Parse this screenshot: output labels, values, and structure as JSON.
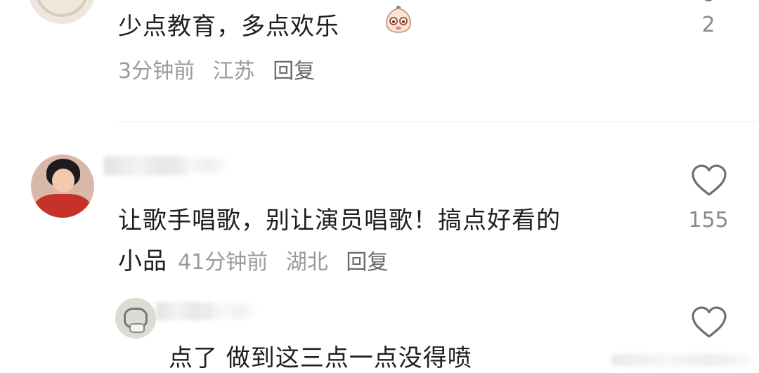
{
  "comments": [
    {
      "text": "少点教育，多点欢乐",
      "emoji": "peach-face-emoji",
      "meta": {
        "time": "3分钟前",
        "location": "江苏",
        "reply": "回复"
      },
      "likes": "2"
    },
    {
      "text_line1": "让歌手唱歌，别让演员唱歌！搞点好看的",
      "text_line2": "小品",
      "meta": {
        "time": "41分钟前",
        "location": "湖北",
        "reply": "回复"
      },
      "likes": "155"
    },
    {
      "text": "点了 做到这三点一点没得喷"
    }
  ],
  "colors": {
    "text": "#1e1e1e",
    "meta": "#9a9a9a",
    "icon": "#6f6f6f"
  }
}
